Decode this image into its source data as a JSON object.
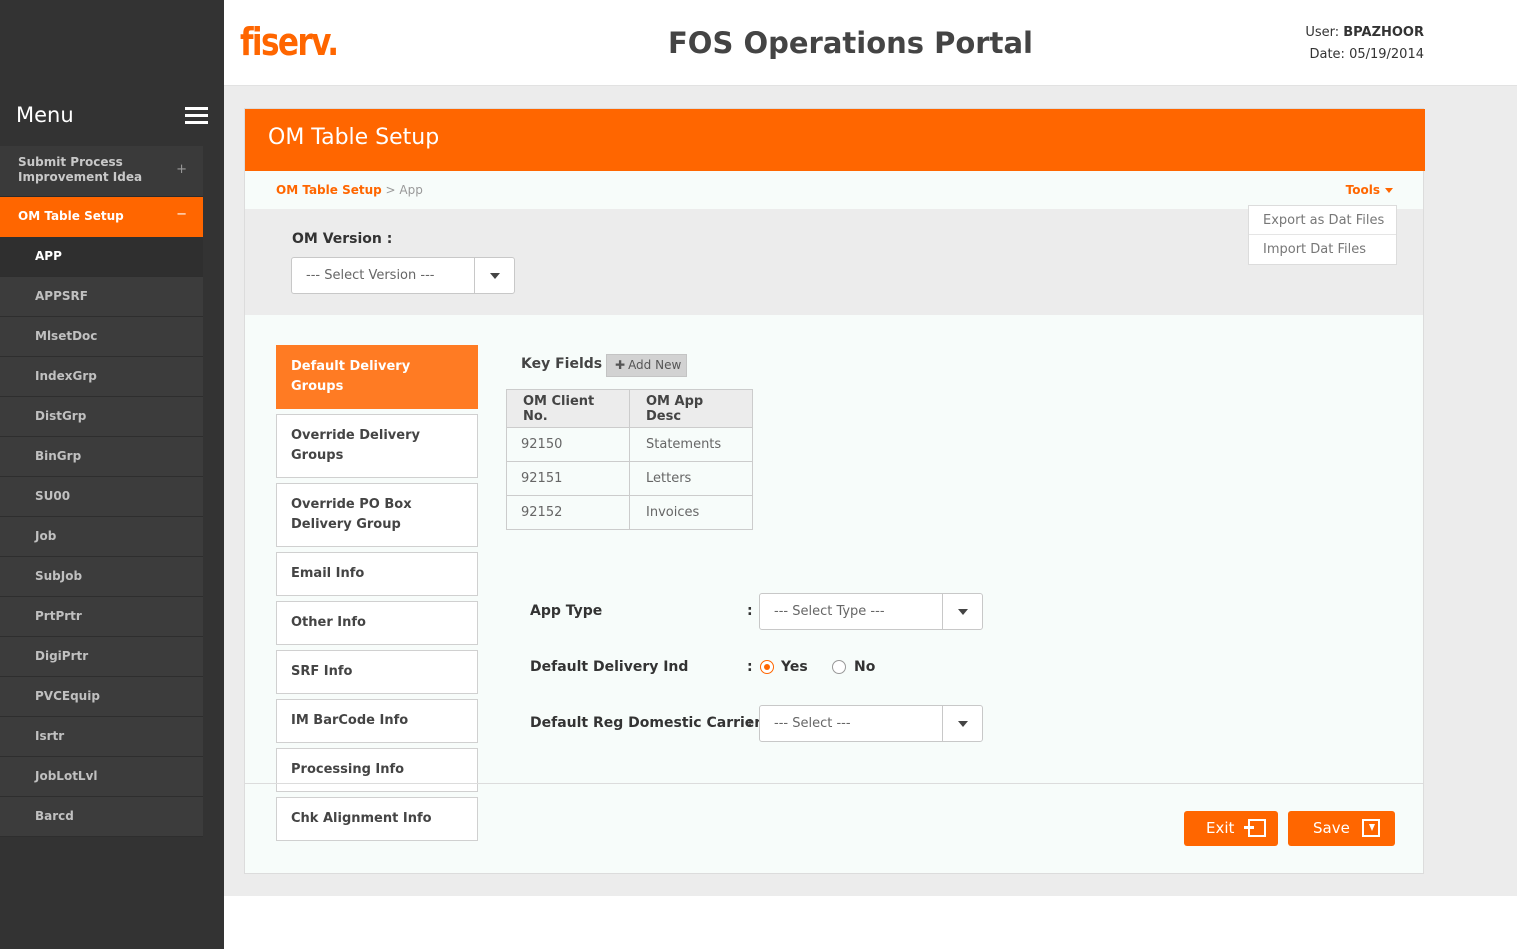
{
  "sidebar": {
    "menu_title": "Menu",
    "items": [
      {
        "label": "Submit Process Improvement Idea",
        "sign": "+"
      },
      {
        "label": "OM Table Setup",
        "sign": "−"
      }
    ],
    "subitems": [
      "APP",
      "APPSRF",
      "MlsetDoc",
      "IndexGrp",
      "DistGrp",
      "BinGrp",
      "SU00",
      "Job",
      "SubJob",
      "PrtPrtr",
      "DigiPrtr",
      "PVCEquip",
      "Isrtr",
      "JobLotLvl",
      "Barcd"
    ]
  },
  "header": {
    "logo": "fiserv.",
    "title": "FOS Operations Portal",
    "user_label": "User:",
    "user_name": "BPAZHOOR",
    "date_label": "Date:",
    "date_value": "05/19/2014"
  },
  "card": {
    "title": "OM Table Setup",
    "breadcrumb_link": "OM Table Setup",
    "breadcrumb_sep": " > ",
    "breadcrumb_current": "App",
    "tools_label": "Tools",
    "tools_menu": [
      "Export as Dat Files",
      "Import Dat Files"
    ],
    "version_label": "OM Version :",
    "version_placeholder": "--- Select Version ---"
  },
  "tabs": [
    "Default Delivery Groups",
    "Override Delivery Groups",
    "Override PO Box Delivery Group",
    "Email Info",
    "Other Info",
    "SRF Info",
    "IM BarCode Info",
    "Processing Info",
    "Chk Alignment Info"
  ],
  "key_fields": {
    "title": "Key Fields",
    "add_new": "Add New",
    "columns": [
      "OM Client No.",
      "OM App Desc"
    ],
    "rows": [
      [
        "92150",
        "Statements"
      ],
      [
        "92151",
        "Letters"
      ],
      [
        "92152",
        "Invoices"
      ]
    ]
  },
  "form": {
    "app_type_label": "App Type",
    "app_type_placeholder": "--- Select Type ---",
    "default_delivery_label": "Default Delivery Ind",
    "yes_label": "Yes",
    "no_label": "No",
    "carrier_label": "Default Reg Domestic Carrier",
    "carrier_placeholder": "--- Select ---",
    "colon": ":"
  },
  "actions": {
    "exit_label": "Exit",
    "save_label": "Save"
  },
  "colors": {
    "accent": "#ff6600",
    "sidebar": "#333333"
  }
}
